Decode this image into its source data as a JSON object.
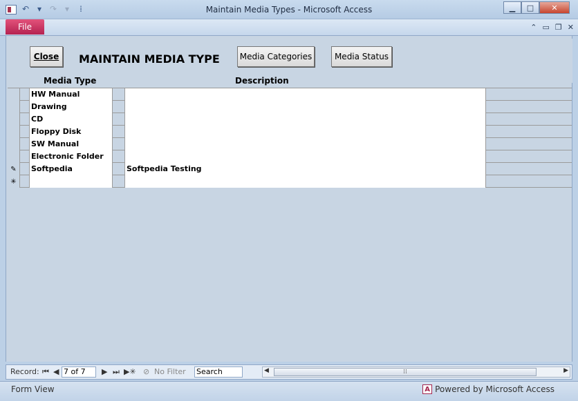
{
  "window": {
    "title": "Maintain Media Types  -  Microsoft Access",
    "minimize_icon": "minimize-icon",
    "maximize_icon": "maximize-icon",
    "close_icon": "close-icon"
  },
  "ribbon": {
    "file_tab": "File"
  },
  "form": {
    "close_label": "Close",
    "heading": "MAINTAIN MEDIA TYPE",
    "media_categories_label": "Media Categories",
    "media_status_label": "Media Status",
    "col_media_type": "Media Type",
    "col_description": "Description"
  },
  "rows": [
    {
      "media_type": "HW Manual",
      "description": "",
      "marker": ""
    },
    {
      "media_type": "Drawing",
      "description": "",
      "marker": ""
    },
    {
      "media_type": "CD",
      "description": "",
      "marker": ""
    },
    {
      "media_type": "Floppy Disk",
      "description": "",
      "marker": ""
    },
    {
      "media_type": "SW Manual",
      "description": "",
      "marker": ""
    },
    {
      "media_type": "Electronic Folder",
      "description": "",
      "marker": ""
    },
    {
      "media_type": "Softpedia",
      "description": "Softpedia Testing",
      "marker": "✎"
    },
    {
      "media_type": "",
      "description": "",
      "marker": "✳"
    }
  ],
  "nav": {
    "record_label": "Record:",
    "record_value": "7 of 7",
    "no_filter_label": "No Filter",
    "search_placeholder": "Search"
  },
  "status": {
    "view": "Form View",
    "powered": "Powered by Microsoft Access"
  }
}
